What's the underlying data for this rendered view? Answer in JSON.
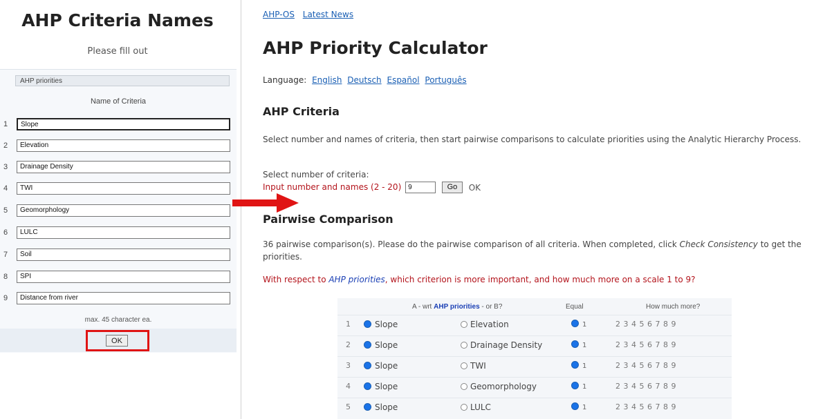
{
  "left_panel": {
    "title": "AHP Criteria Names",
    "subtitle": "Please fill out",
    "goal_value": "AHP priorities",
    "column_header": "Name of Criteria",
    "criteria": [
      {
        "num": "1",
        "name": "Slope"
      },
      {
        "num": "2",
        "name": "Elevation"
      },
      {
        "num": "3",
        "name": "Drainage Density"
      },
      {
        "num": "4",
        "name": "TWI"
      },
      {
        "num": "5",
        "name": "Geomorphology"
      },
      {
        "num": "6",
        "name": "LULC"
      },
      {
        "num": "7",
        "name": "Soil"
      },
      {
        "num": "8",
        "name": "SPI"
      },
      {
        "num": "9",
        "name": "Distance from river"
      }
    ],
    "max_note": "max. 45 character ea.",
    "ok_label": "OK"
  },
  "nav": {
    "link1": "AHP-OS",
    "link2": "Latest News"
  },
  "page": {
    "title": "AHP Priority Calculator",
    "language_label": "Language:",
    "languages": [
      "English",
      "Deutsch",
      "Español",
      "Português"
    ]
  },
  "criteria_section": {
    "heading": "AHP Criteria",
    "description": "Select number and names of criteria, then start pairwise comparisons to calculate priorities using the Analytic Hierarchy Process.",
    "select_label": "Select number of criteria:",
    "input_label": "Input number and names (2 - 20)",
    "input_value": "9",
    "go_label": "Go",
    "status": "OK"
  },
  "pairwise": {
    "heading": "Pairwise Comparison",
    "description_pre": "36 pairwise comparison(s). Please do the pairwise comparison of all criteria. When completed, click ",
    "description_link": "Check Consistency",
    "description_post": " to get the priorities.",
    "question_pre": "With respect to ",
    "question_goal": "AHP priorities",
    "question_post": ", which criterion is more important, and how much more on a scale 1 to 9?",
    "table_header": {
      "col_ab_pre": "A - wrt ",
      "col_ab_goal": "AHP priorities",
      "col_ab_post": " - or B?",
      "col_equal": "Equal",
      "col_more": "How much more?"
    },
    "rows": [
      {
        "num": "1",
        "a": "Slope",
        "b": "Elevation",
        "equal": "1",
        "scale": "2 3 4 5 6 7 8 9"
      },
      {
        "num": "2",
        "a": "Slope",
        "b": "Drainage Density",
        "equal": "1",
        "scale": "2 3 4 5 6 7 8 9"
      },
      {
        "num": "3",
        "a": "Slope",
        "b": "TWI",
        "equal": "1",
        "scale": "2 3 4 5 6 7 8 9"
      },
      {
        "num": "4",
        "a": "Slope",
        "b": "Geomorphology",
        "equal": "1",
        "scale": "2 3 4 5 6 7 8 9"
      },
      {
        "num": "5",
        "a": "Slope",
        "b": "LULC",
        "equal": "1",
        "scale": "2 3 4 5 6 7 8 9"
      }
    ]
  },
  "colors": {
    "accent_red": "#e01414",
    "link_blue": "#1a5fb4",
    "heading_red": "#b3131b"
  }
}
